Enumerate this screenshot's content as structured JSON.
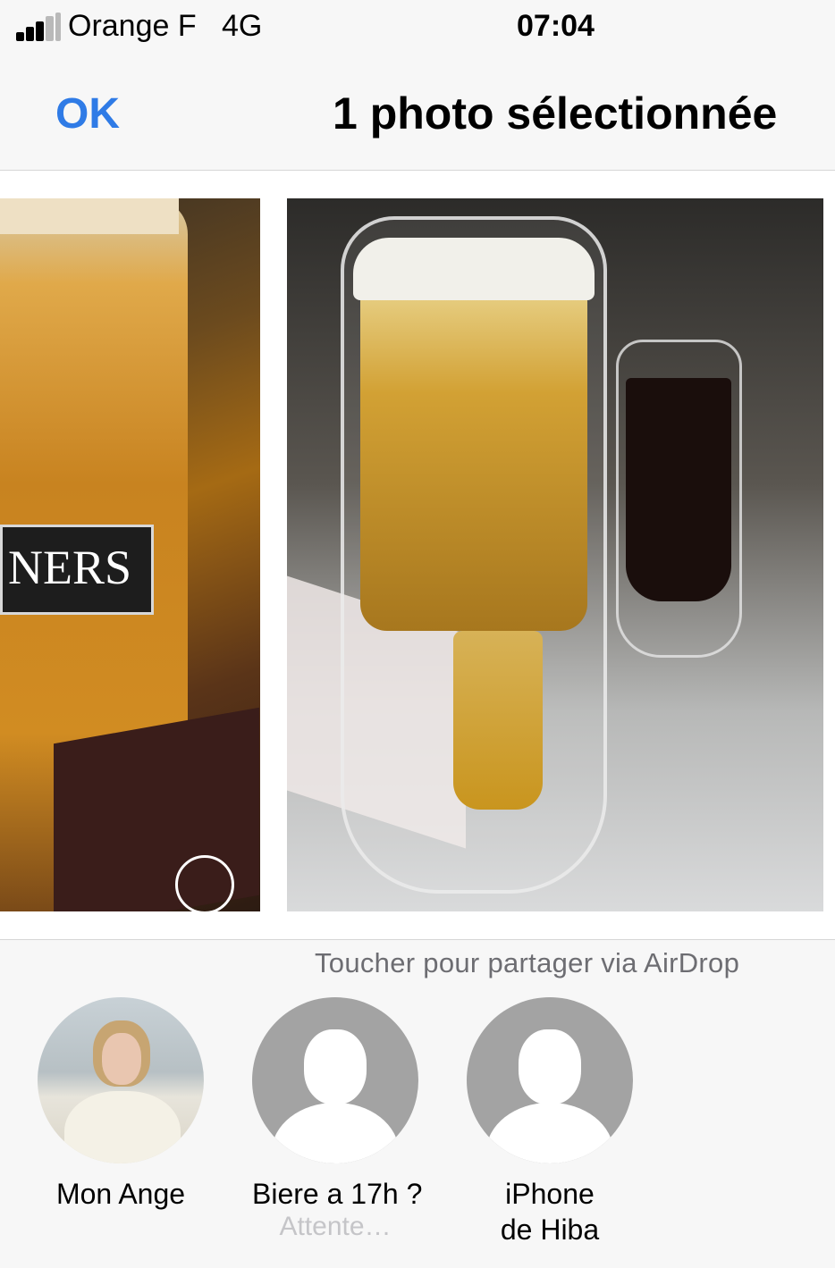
{
  "status_bar": {
    "carrier": "Orange F",
    "network": "4G",
    "time": "07:04",
    "signal_bars_filled": 3,
    "signal_bars_total": 5
  },
  "nav": {
    "ok_label": "OK",
    "title": "1 photo sélectionnée"
  },
  "photos": [
    {
      "selected": false,
      "label_text": "NERS"
    },
    {
      "selected": true,
      "check_icon": "✓"
    }
  ],
  "airdrop": {
    "hint": "Toucher pour partager via AirDrop",
    "contacts": [
      {
        "name": "Mon Ange",
        "status": "",
        "avatar": "photo"
      },
      {
        "name": "Biere a 17h ?",
        "status": "Attente…",
        "avatar": "silhouette"
      },
      {
        "name_line1": "iPhone",
        "name_line2": "de Hiba",
        "status": "",
        "avatar": "silhouette"
      }
    ]
  },
  "colors": {
    "accent": "#2f7be6",
    "selected_badge": "#2b70d8",
    "placeholder_avatar": "#a3a3a3"
  }
}
